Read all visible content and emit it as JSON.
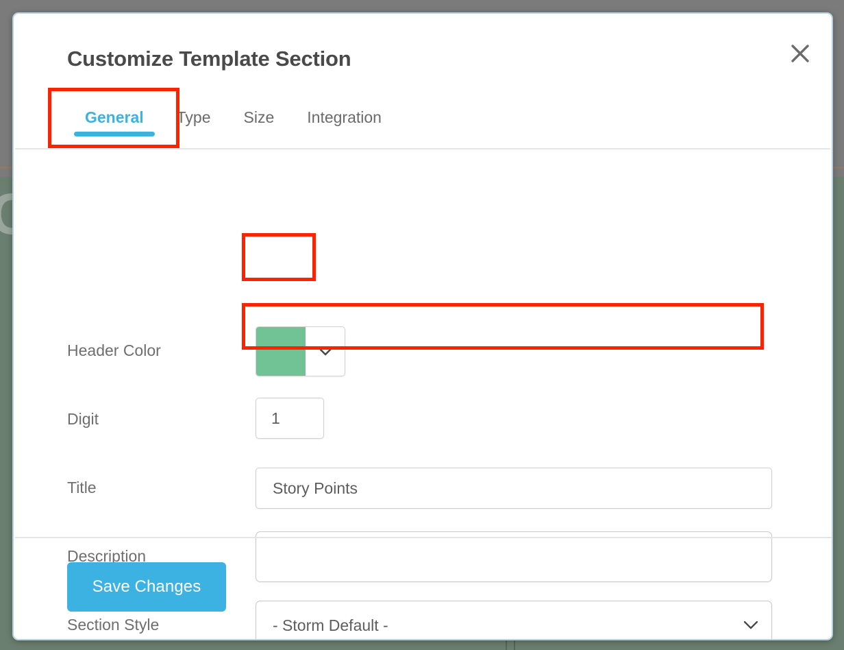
{
  "background": {
    "glyph": "C",
    "note": "dimmed page behind modal"
  },
  "modal": {
    "title": "Customize Template Section",
    "close_label": "×",
    "close_icon": "close-icon"
  },
  "tabs": {
    "items": [
      {
        "label": "General",
        "active": true
      },
      {
        "label": "Type",
        "active": false
      },
      {
        "label": "Size",
        "active": false
      },
      {
        "label": "Integration",
        "active": false
      }
    ]
  },
  "form": {
    "header_color": {
      "label": "Header Color",
      "value": "#71c294",
      "caret_icon": "chevron-down-icon"
    },
    "digit": {
      "label": "Digit",
      "value": "1",
      "placeholder": ""
    },
    "title": {
      "label": "Title",
      "value": "Story Points",
      "placeholder": ""
    },
    "description": {
      "label": "Description",
      "value": "",
      "placeholder": ""
    },
    "section_style": {
      "label": "Section Style",
      "value": "- Storm Default -",
      "caret_icon": "chevron-down-icon"
    }
  },
  "footer": {
    "save_label": "Save Changes"
  },
  "colors": {
    "accent": "#3cb2e2",
    "highlight": "#fa2400",
    "header_swatch": "#71c294",
    "label_text": "#6e6e6e",
    "title_text": "#4a4a4a"
  }
}
